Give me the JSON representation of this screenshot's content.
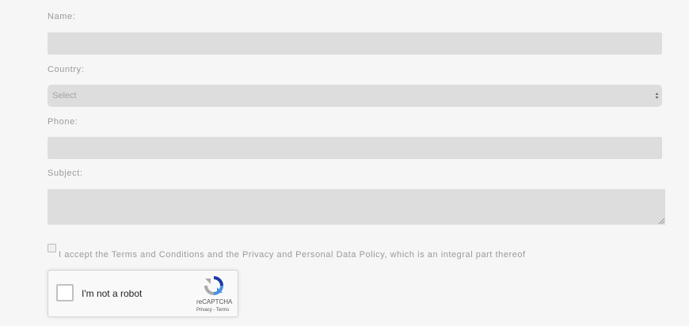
{
  "form": {
    "name_label": "Name:",
    "country_label": "Country:",
    "country_select_value": "Select",
    "phone_label": "Phone:",
    "subject_label": "Subject:",
    "terms_text": "I accept the Terms and Conditions and the Privacy and Personal Data Policy, which is an integral part thereof"
  },
  "recaptcha": {
    "label": "I'm not a robot",
    "brand": "reCAPTCHA",
    "privacy": "Privacy",
    "separator": " - ",
    "terms": "Terms",
    "icons": {
      "logo": "recaptcha-logo-icon",
      "checkbox": "checkbox-icon"
    }
  },
  "colors": {
    "background": "#f6f6f6",
    "field": "#dddddd",
    "label": "#9a9a9a",
    "recaptcha_blue": "#4a90e2",
    "recaptcha_gray": "#aaaaaa"
  }
}
